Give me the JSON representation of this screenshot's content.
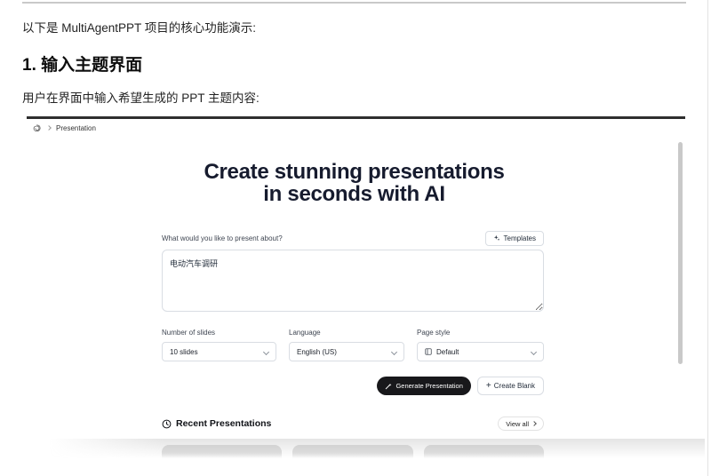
{
  "document": {
    "intro": "以下是 MultiAgentPPT 项目的核心功能演示:",
    "heading": "1. 输入主题界面",
    "description": "用户在界面中输入希望生成的 PPT 主题内容:"
  },
  "app": {
    "breadcrumb": "Presentation",
    "hero": {
      "line1": "Create stunning presentations",
      "line2": "in seconds with AI"
    },
    "prompt_label": "What would you like to present about?",
    "prompt_value": "电动汽车调研",
    "templates_button": "Templates",
    "options": [
      {
        "label": "Number of slides",
        "value": "10 slides"
      },
      {
        "label": "Language",
        "value": "English (US)"
      },
      {
        "label": "Page style",
        "value": "Default"
      }
    ],
    "generate_button": "Generate Presentation",
    "plus_glyph": "+",
    "create_blank_button": "Create Blank",
    "recent_title": "Recent Presentations",
    "view_all": "View all",
    "skeleton_card_count": 3
  },
  "icons": {
    "breadcrumb_logo": "scribble-logo-icon",
    "breadcrumb_separator": "chevron-right-icon",
    "templates": "sparkles-icon",
    "selects": "chevron-down-icon",
    "page_style": "layout-icon",
    "generate": "wand-icon",
    "create_blank": "plus-icon",
    "recent": "clock-icon",
    "view_all": "chevron-right-icon"
  },
  "colors": {
    "dark_button_bg": "#18181b",
    "dark_button_text": "#ffffff",
    "border": "#d9dde3",
    "heading_text": "#161b2e",
    "skeleton": "#d2d2d2",
    "scrollbar": "#c9c9c9",
    "screenshot_top_border": "#2e2e2e"
  }
}
